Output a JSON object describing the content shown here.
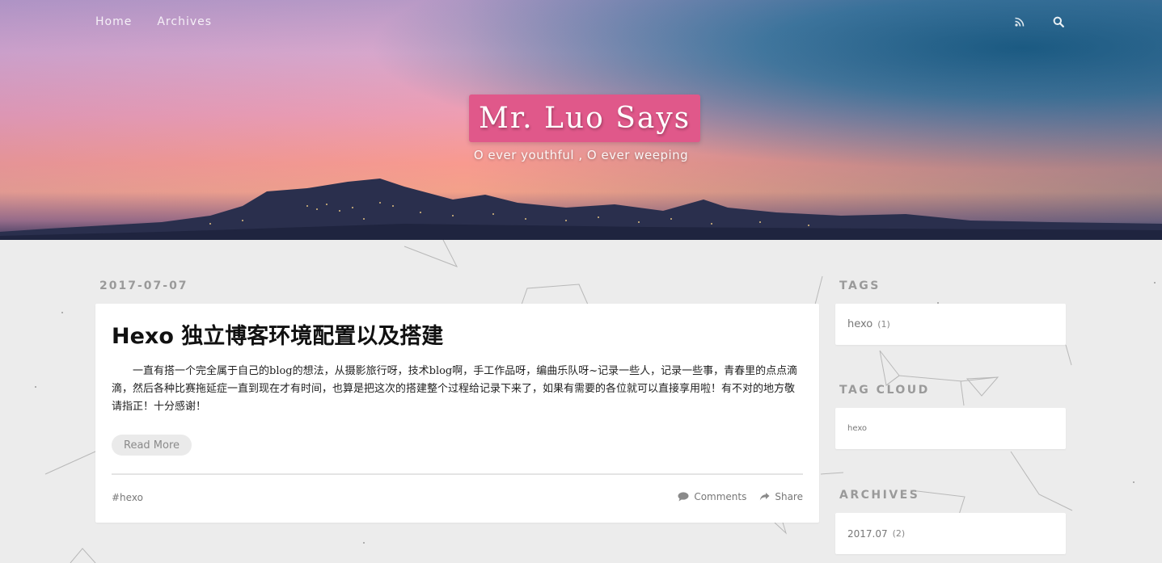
{
  "nav": {
    "items": [
      {
        "label": "Home"
      },
      {
        "label": "Archives"
      }
    ],
    "icons": [
      "rss-icon",
      "search-icon"
    ]
  },
  "header": {
    "site_title": "Mr. Luo Says",
    "tagline": "O ever youthful , O ever weeping",
    "brand_color": "#e0588a"
  },
  "post": {
    "date": "2017-07-07",
    "title": "Hexo 独立博客环境配置以及搭建",
    "excerpt": "一直有搭一个完全属于自己的blog的想法，从摄影旅行呀，技术blog啊，手工作品呀，编曲乐队呀~记录一些人，记录一些事，青春里的点点滴滴，然后各种比赛拖延症一直到现在才有时间，也算是把这次的搭建整个过程给记录下来了，如果有需要的各位就可以直接享用啦！有不对的地方敬请指正！十分感谢！",
    "read_more": "Read More",
    "tag": "#hexo",
    "comments_label": "Comments",
    "share_label": "Share"
  },
  "sidebar": {
    "tags": {
      "title": "TAGS",
      "items": [
        {
          "name": "hexo",
          "count": "(1)"
        }
      ]
    },
    "tag_cloud": {
      "title": "TAG CLOUD",
      "items": [
        {
          "name": "hexo"
        }
      ]
    },
    "archives": {
      "title": "ARCHIVES",
      "items": [
        {
          "name": "2017.07",
          "count": "(2)"
        }
      ]
    }
  }
}
